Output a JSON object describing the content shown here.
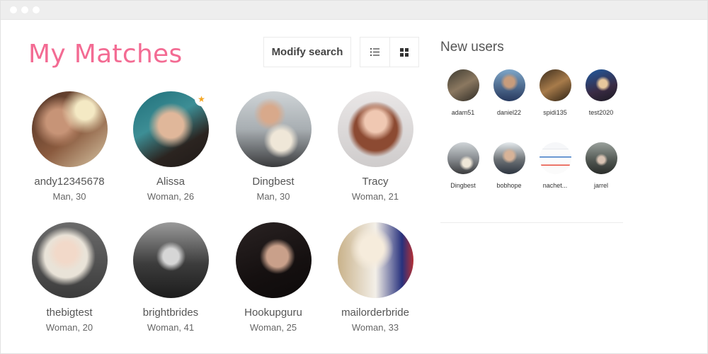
{
  "header": {
    "title": "My Matches",
    "modify_search_label": "Modify search"
  },
  "view_icons": {
    "list": "list-icon",
    "grid": "grid-icon"
  },
  "colors": {
    "accent": "#f36b93",
    "star": "#f5a623"
  },
  "matches": [
    {
      "name": "andy12345678",
      "info": "Man, 30"
    },
    {
      "name": "Alissa",
      "info": "Woman, 26",
      "featured": true
    },
    {
      "name": "Dingbest",
      "info": "Man, 30"
    },
    {
      "name": "Tracy",
      "info": "Woman, 21"
    },
    {
      "name": "thebigtest",
      "info": "Woman, 20"
    },
    {
      "name": "brightbrides",
      "info": "Woman, 41"
    },
    {
      "name": "Hookupguru",
      "info": "Woman, 25"
    },
    {
      "name": "mailorderbride",
      "info": "Woman, 33"
    }
  ],
  "new_users": {
    "title": "New users",
    "users": [
      {
        "name": "adam51"
      },
      {
        "name": "daniel22"
      },
      {
        "name": "spidi135"
      },
      {
        "name": "test2020"
      },
      {
        "name": "Dingbest"
      },
      {
        "name": "bobhope"
      },
      {
        "name": "nachet..."
      },
      {
        "name": "jarrel"
      }
    ]
  }
}
